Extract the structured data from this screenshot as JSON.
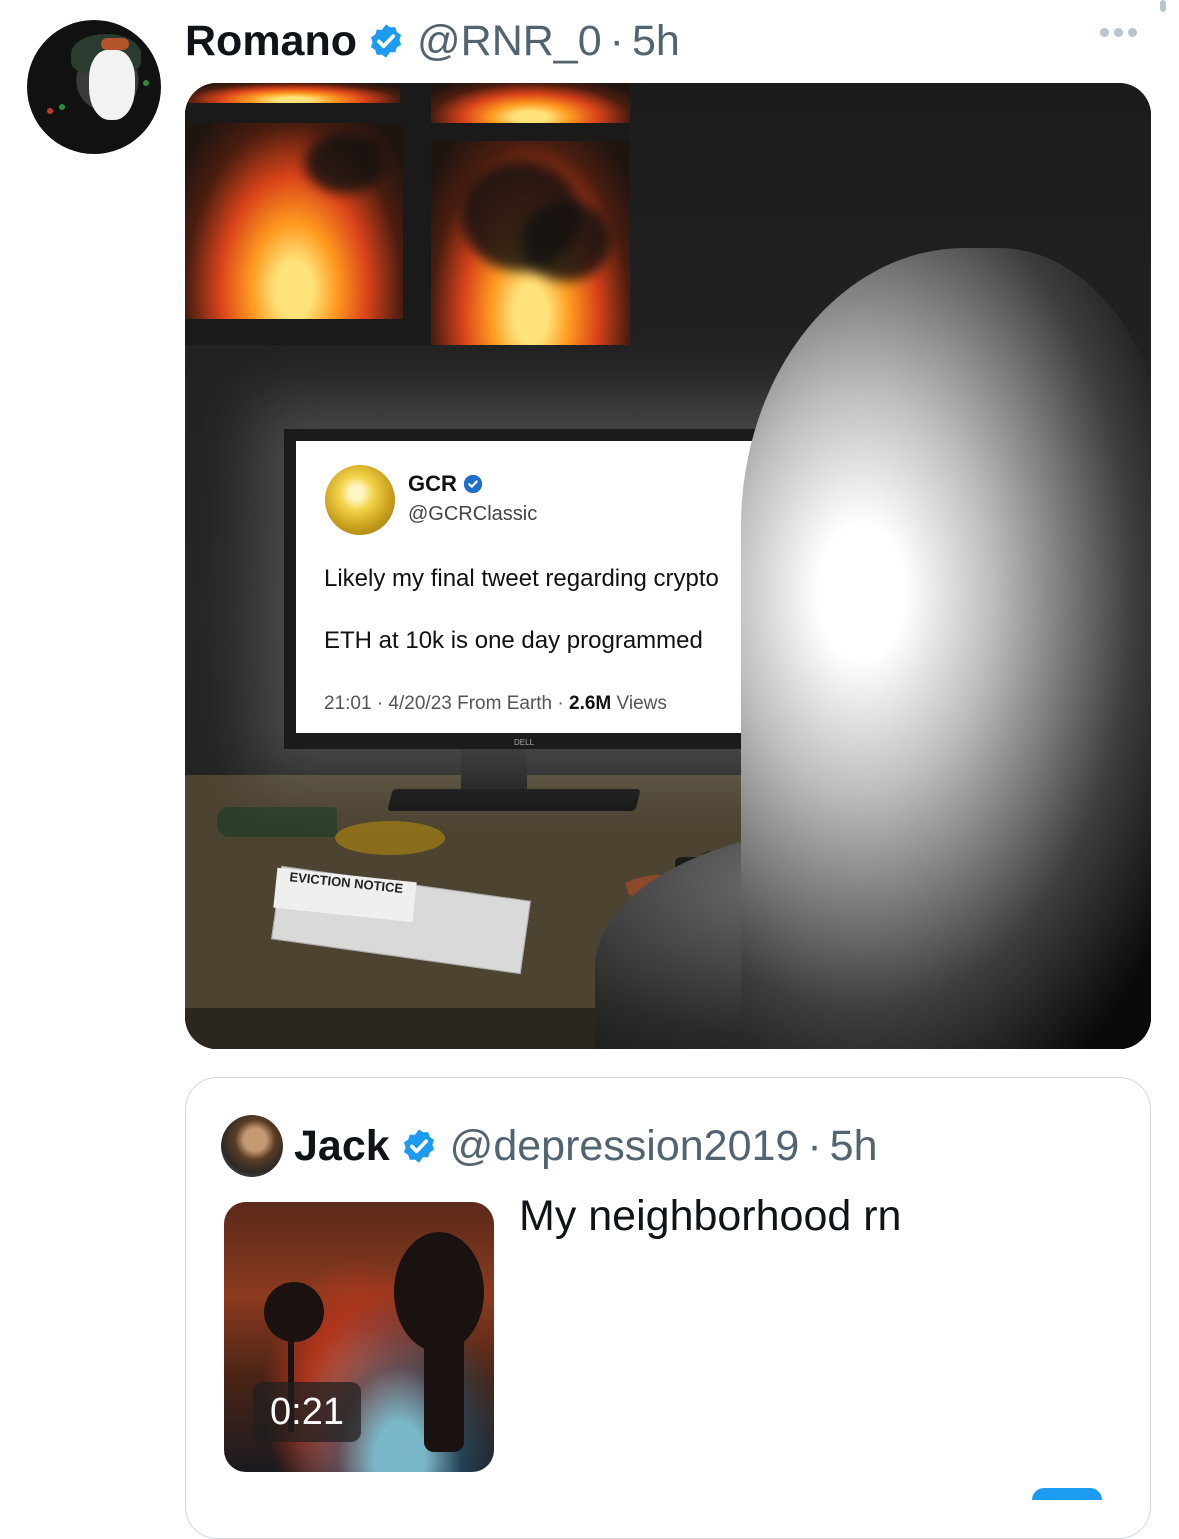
{
  "tweet": {
    "author_name": "Romano",
    "handle": "@RNR_0",
    "separator": "·",
    "time": "5h",
    "verified_color": "#1d9bf0"
  },
  "media": {
    "screen_tweet": {
      "name": "GCR",
      "handle": "@GCRClassic",
      "line1": "Likely my final tweet regarding crypto",
      "line2": "ETH at 10k is one day programmed",
      "meta_prefix": "21:01 · 4/20/23 From Earth · ",
      "meta_views_count": "2.6M",
      "meta_views_label": " Views"
    },
    "monitor_brand": "DELL",
    "notice_label": "EVICTION NOTICE"
  },
  "quote": {
    "author_name": "Jack",
    "handle": "@depression2019",
    "separator": "·",
    "time": "5h",
    "text": "My neighborhood rn",
    "video_duration": "0:21"
  }
}
